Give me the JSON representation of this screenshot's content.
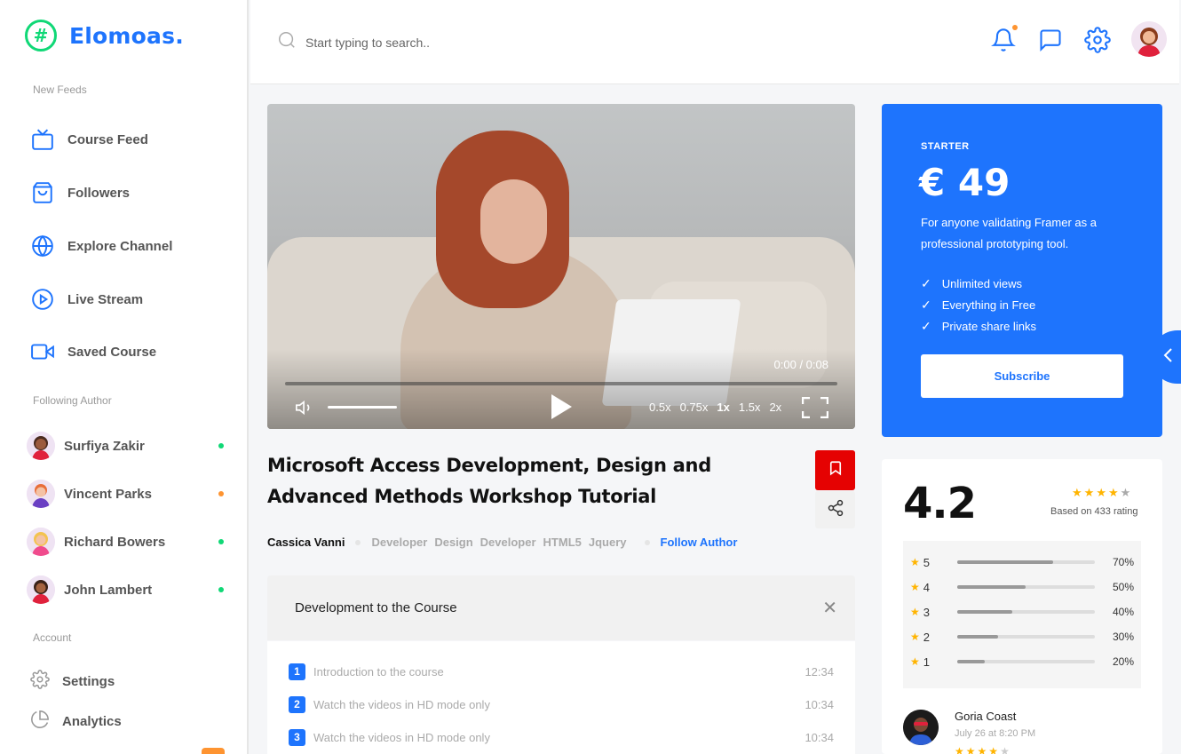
{
  "brand": {
    "name": "Elomoas.",
    "mark": "#"
  },
  "sidebar": {
    "section_feeds": "New Feeds",
    "items": [
      {
        "label": "Course Feed",
        "icon": "tv-icon"
      },
      {
        "label": "Followers",
        "icon": "shopping-bag-icon"
      },
      {
        "label": "Explore Channel",
        "icon": "globe-icon"
      },
      {
        "label": "Live Stream",
        "icon": "play-circle-icon"
      },
      {
        "label": "Saved Course",
        "icon": "video-camera-icon"
      }
    ],
    "section_authors": "Following Author",
    "authors": [
      {
        "name": "Surfiya Zakir",
        "status_color": "#10d876"
      },
      {
        "name": "Vincent Parks",
        "status_color": "#fe9431"
      },
      {
        "name": "Richard Bowers",
        "status_color": "#10d876"
      },
      {
        "name": "John Lambert",
        "status_color": "#10d876"
      }
    ],
    "section_account": "Account",
    "account": [
      {
        "label": "Settings",
        "icon": "gear-icon"
      },
      {
        "label": "Analytics",
        "icon": "pie-chart-icon"
      }
    ]
  },
  "header": {
    "search_placeholder": "Start typing to search..",
    "icons": [
      "bell-icon",
      "chat-icon",
      "gear-icon"
    ]
  },
  "video": {
    "time": "0:00 / 0:08",
    "speeds": [
      "0.5x",
      "0.75x",
      "1x",
      "1.5x",
      "2x"
    ],
    "active_speed": "1x",
    "volume_level": 0.55
  },
  "course": {
    "title": "Microsoft Access Development, Design and Advanced Methods Workshop Tutorial",
    "author": "Cassica Vanni",
    "tags": [
      "Developer",
      "Design",
      "Developer",
      "HTML5",
      "Jquery"
    ],
    "follow_label": "Follow Author"
  },
  "accordion": {
    "title": "Development to the Course",
    "lessons": [
      {
        "num": "1",
        "title": "Introduction to the course",
        "duration": "12:34"
      },
      {
        "num": "2",
        "title": "Watch the videos in HD mode only",
        "duration": "10:34"
      },
      {
        "num": "3",
        "title": "Watch the videos in HD mode only",
        "duration": "10:34"
      }
    ]
  },
  "pricing": {
    "tier": "STARTER",
    "price": "€ 49",
    "description": "For anyone validating Framer as a professional prototyping tool.",
    "features": [
      "Unlimited views",
      "Everything in Free",
      "Private share links"
    ],
    "button": "Subscribe",
    "accent": "#1e74fd"
  },
  "rating": {
    "score": "4.2",
    "stars": 4,
    "based_on": "Based on 433 rating",
    "breakdown": [
      {
        "star": "5",
        "percent": "70%",
        "fill": 0.7
      },
      {
        "star": "4",
        "percent": "50%",
        "fill": 0.5
      },
      {
        "star": "3",
        "percent": "40%",
        "fill": 0.4
      },
      {
        "star": "2",
        "percent": "30%",
        "fill": 0.3
      },
      {
        "star": "1",
        "percent": "20%",
        "fill": 0.2
      }
    ],
    "review": {
      "name": "Goria Coast",
      "date": "July 26 at 8:20 PM",
      "stars": 4
    }
  }
}
